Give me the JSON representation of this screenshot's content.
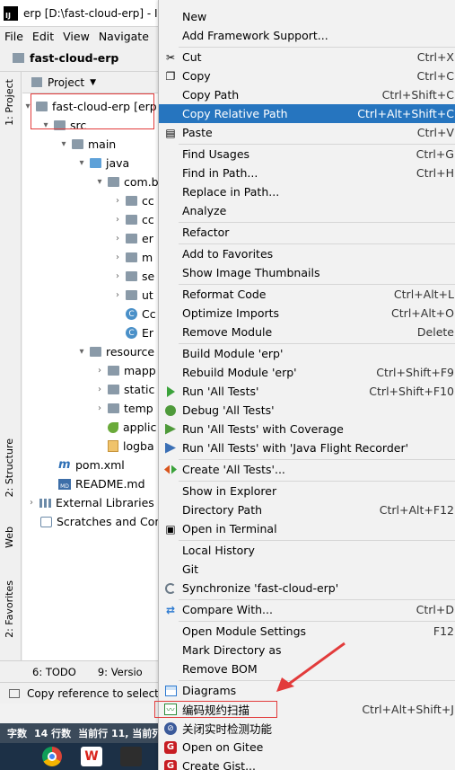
{
  "window": {
    "title": "erp [D:\\fast-cloud-erp] - In",
    "logo_text": "IJ"
  },
  "menubar": [
    "File",
    "Edit",
    "View",
    "Navigate"
  ],
  "navbar": {
    "project": "fast-cloud-erp"
  },
  "left_tabs": {
    "project": "1: Project",
    "structure": "2: Structure",
    "web": "Web",
    "favorites": "2: Favorites"
  },
  "panel": {
    "header": "Project"
  },
  "tree": {
    "root": "fast-cloud-erp [erp",
    "src": "src",
    "main": "main",
    "java": "java",
    "pkg": "com.b",
    "sub1": "cc",
    "sub2": "cc",
    "sub3": "er",
    "sub4": "m",
    "sub5": "se",
    "sub6": "ut",
    "cls1": "Cc",
    "cls2": "Er",
    "resources": "resource",
    "mapper": "mapp",
    "static": "static",
    "templates": "temp",
    "application": "applic",
    "logback": "logba",
    "pom": "pom.xml",
    "readme": "README.md",
    "md_badge": "MD",
    "ext_libs": "External Libraries",
    "scratches": "Scratches and Cons"
  },
  "bottom_tabs": {
    "todo": "6: TODO",
    "version": "9: Versio"
  },
  "status": {
    "text": "Copy reference to selecte"
  },
  "wordbar": {
    "chars": "字数",
    "lines": "14 行数",
    "cur": "当前行 11, 当前列"
  },
  "taskbar": {
    "wps": "W"
  },
  "menu": {
    "new": {
      "label": "New",
      "sc": ""
    },
    "add_fw": {
      "label": "Add Framework Support...",
      "sc": ""
    },
    "cut": {
      "label": "Cut",
      "sc": "Ctrl+X"
    },
    "copy": {
      "label": "Copy",
      "sc": "Ctrl+C"
    },
    "copy_path": {
      "label": "Copy Path",
      "sc": "Ctrl+Shift+C"
    },
    "copy_rel": {
      "label": "Copy Relative Path",
      "sc": "Ctrl+Alt+Shift+C"
    },
    "paste": {
      "label": "Paste",
      "sc": "Ctrl+V"
    },
    "find_usages": {
      "label": "Find Usages",
      "sc": "Ctrl+G"
    },
    "find_path": {
      "label": "Find in Path...",
      "sc": "Ctrl+H"
    },
    "replace_path": {
      "label": "Replace in Path...",
      "sc": ""
    },
    "analyze": {
      "label": "Analyze",
      "sc": ""
    },
    "refactor": {
      "label": "Refactor",
      "sc": ""
    },
    "add_fav": {
      "label": "Add to Favorites",
      "sc": ""
    },
    "show_thumb": {
      "label": "Show Image Thumbnails",
      "sc": ""
    },
    "reformat": {
      "label": "Reformat Code",
      "sc": "Ctrl+Alt+L"
    },
    "optimize": {
      "label": "Optimize Imports",
      "sc": "Ctrl+Alt+O"
    },
    "remove_mod": {
      "label": "Remove Module",
      "sc": "Delete"
    },
    "build_mod": {
      "label": "Build Module 'erp'",
      "sc": ""
    },
    "rebuild_mod": {
      "label": "Rebuild Module 'erp'",
      "sc": "Ctrl+Shift+F9"
    },
    "run_all": {
      "label": "Run 'All Tests'",
      "sc": "Ctrl+Shift+F10"
    },
    "debug_all": {
      "label": "Debug 'All Tests'",
      "sc": ""
    },
    "run_cov": {
      "label": "Run 'All Tests' with Coverage",
      "sc": ""
    },
    "run_jfr": {
      "label": "Run 'All Tests' with 'Java Flight Recorder'",
      "sc": ""
    },
    "create_all": {
      "label": "Create 'All Tests'...",
      "sc": ""
    },
    "show_explorer": {
      "label": "Show in Explorer",
      "sc": ""
    },
    "dir_path": {
      "label": "Directory Path",
      "sc": "Ctrl+Alt+F12"
    },
    "open_term": {
      "label": "Open in Terminal",
      "sc": ""
    },
    "local_hist": {
      "label": "Local History",
      "sc": ""
    },
    "git": {
      "label": "Git",
      "sc": ""
    },
    "sync": {
      "label": "Synchronize 'fast-cloud-erp'",
      "sc": ""
    },
    "compare": {
      "label": "Compare With...",
      "sc": "Ctrl+D"
    },
    "open_mod_settings": {
      "label": "Open Module Settings",
      "sc": "F12"
    },
    "mark_dir": {
      "label": "Mark Directory as",
      "sc": ""
    },
    "remove_bom": {
      "label": "Remove BOM",
      "sc": ""
    },
    "diagrams": {
      "label": "Diagrams",
      "sc": ""
    },
    "scan": {
      "label": "编码规约扫描",
      "sc": "Ctrl+Alt+Shift+J"
    },
    "close_rt": {
      "label": "关闭实时检测功能",
      "sc": ""
    },
    "open_gitee": {
      "label": "Open on Gitee",
      "sc": ""
    },
    "create_gist": {
      "label": "Create Gist...",
      "sc": ""
    }
  },
  "colors": {
    "selection": "#2675bf",
    "annotation_red": "#e23b3b"
  }
}
